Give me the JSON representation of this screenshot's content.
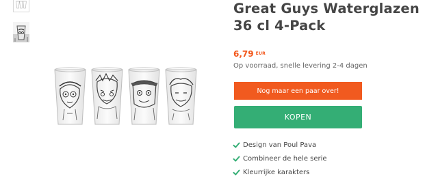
{
  "gallery": {
    "thumbnails": [
      "glasses-row-thumbnail",
      "glass-closeup-thumbnail"
    ]
  },
  "product": {
    "title": "Great Guys Waterglazen 36 cl 4-Pack",
    "price": "6,79",
    "currency": "EUR",
    "stock_text": "Op voorraad, snelle levering 2-4 dagen",
    "low_stock_label": "Nog maar een paar over!",
    "buy_label": "KOPEN",
    "features": [
      "Design van Poul Pava",
      "Combineer de hele serie",
      "Kleurrijke karakters"
    ]
  },
  "colors": {
    "title": "#454545",
    "price": "#f2571b",
    "low_stock_bg": "#f15a1f",
    "buy_bg": "#34ae75",
    "check": "#34ae75"
  }
}
